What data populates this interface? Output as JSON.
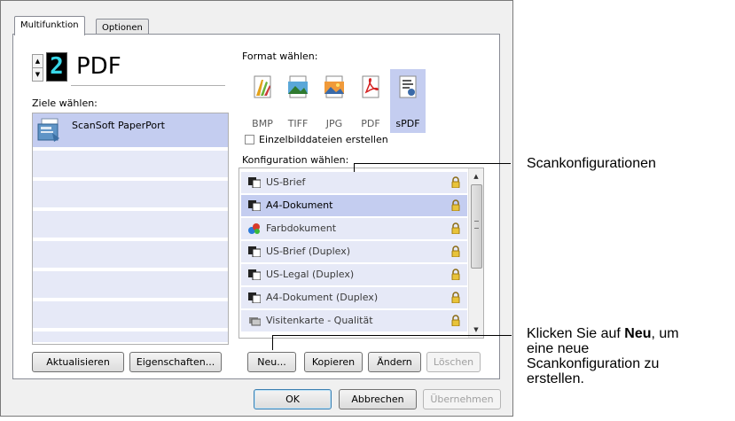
{
  "tabs": [
    "Multifunktion",
    "Optionen"
  ],
  "counter": {
    "digit": "2",
    "format": "PDF"
  },
  "destinations": {
    "label": "Ziele wählen:",
    "items": [
      "ScanSoft PaperPort"
    ]
  },
  "formats": {
    "label": "Format wählen:",
    "items": [
      "BMP",
      "TIFF",
      "JPG",
      "PDF",
      "sPDF"
    ],
    "selected": "sPDF"
  },
  "single_file_checkbox": {
    "label": "Einzelbilddateien erstellen",
    "checked": false
  },
  "configs": {
    "label": "Konfiguration wählen:",
    "items": [
      "US-Brief",
      "A4-Dokument",
      "Farbdokument",
      "US-Brief (Duplex)",
      "US-Legal (Duplex)",
      "A4-Dokument (Duplex)",
      "Visitenkarte - Qualität"
    ],
    "selected": "A4-Dokument"
  },
  "buttons": {
    "refresh": "Aktualisieren",
    "properties": "Eigenschaften...",
    "new": "Neu...",
    "copy": "Kopieren",
    "edit": "Ändern",
    "delete": "Löschen",
    "ok": "OK",
    "cancel": "Abbrechen",
    "apply": "Übernehmen"
  },
  "callouts": {
    "scan": "Scankonfigurationen",
    "new_prefix": "Klicken Sie auf ",
    "new_bold": "Neu",
    "new_suffix": ", um",
    "new_line2": "eine neue",
    "new_line3": "Scankonfiguration zu",
    "new_line4": "erstellen."
  }
}
